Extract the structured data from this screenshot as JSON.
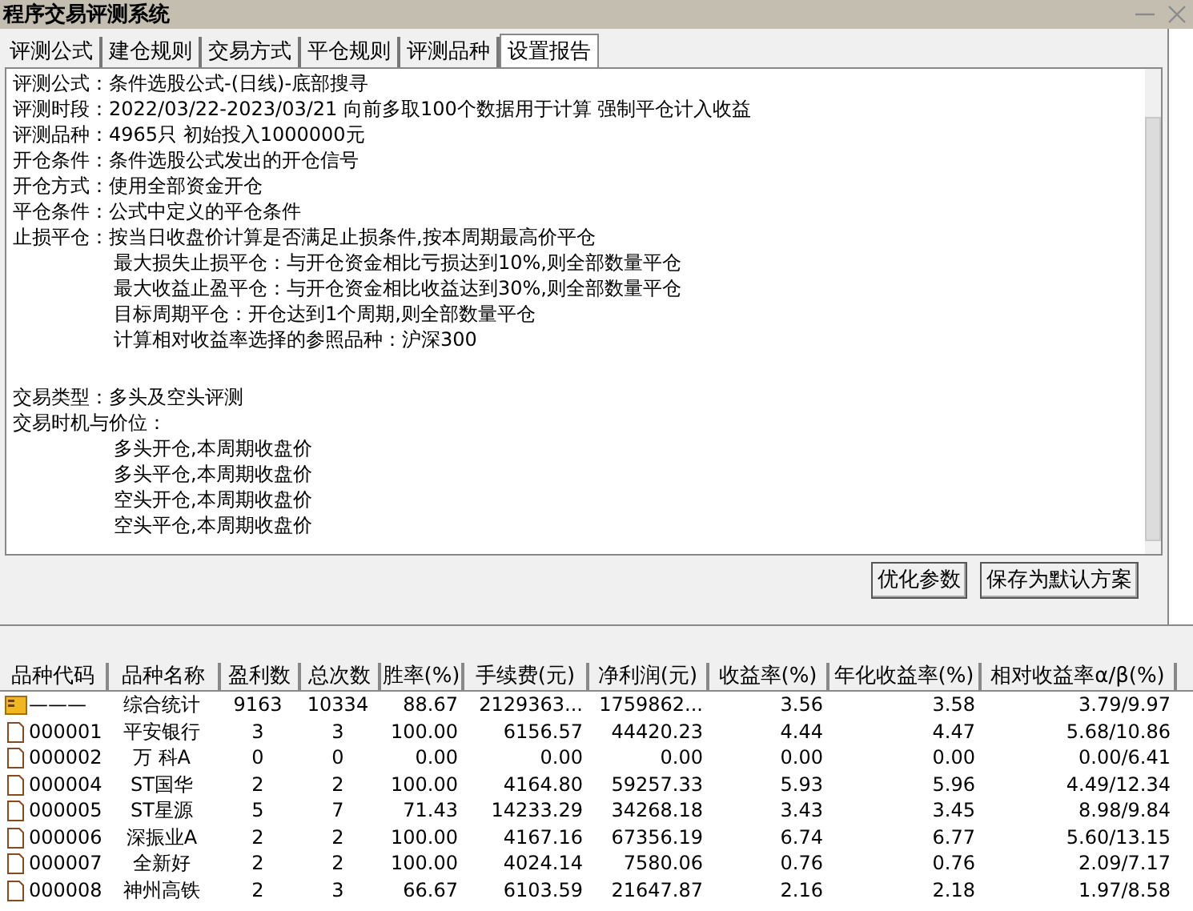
{
  "window": {
    "title": "程序交易评测系统"
  },
  "tabs": [
    {
      "label": "评测公式",
      "selected": false
    },
    {
      "label": "建仓规则",
      "selected": false
    },
    {
      "label": "交易方式",
      "selected": false
    },
    {
      "label": "平仓规则",
      "selected": false
    },
    {
      "label": "评测品种",
      "selected": false
    },
    {
      "label": "设置报告",
      "selected": true
    }
  ],
  "report": {
    "sections": [
      {
        "lines": [
          {
            "kind": "field",
            "label": "评测公式：",
            "text": "条件选股公式-(日线)-底部搜寻"
          },
          {
            "kind": "field",
            "label": "评测时段：",
            "text": "2022/03/22-2023/03/21 向前多取100个数据用于计算 强制平仓计入收益"
          },
          {
            "kind": "field",
            "label": "评测品种：",
            "text": "4965只 初始投入1000000元"
          },
          {
            "kind": "field",
            "label": "开仓条件：",
            "text": "条件选股公式发出的开仓信号"
          },
          {
            "kind": "field",
            "label": "开仓方式：",
            "text": "使用全部资金开仓"
          },
          {
            "kind": "field",
            "label": "平仓条件：",
            "text": "公式中定义的平仓条件"
          },
          {
            "kind": "field",
            "label": "止损平仓：",
            "text": "按当日收盘价计算是否满足止损条件,按本周期最高价平仓"
          },
          {
            "kind": "detail",
            "text": "最大损失止损平仓：与开仓资金相比亏损达到10%,则全部数量平仓"
          },
          {
            "kind": "detail",
            "text": "最大收益止盈平仓：与开仓资金相比收益达到30%,则全部数量平仓"
          },
          {
            "kind": "detail",
            "text": "目标周期平仓：开仓达到1个周期,则全部数量平仓"
          },
          {
            "kind": "detail",
            "text": "计算相对收益率选择的参照品种：沪深300"
          }
        ]
      },
      {
        "lines": [
          {
            "kind": "field",
            "label": "交易类型：",
            "text": "多头及空头评测"
          },
          {
            "kind": "field",
            "label": "交易时机与价位："
          },
          {
            "kind": "detail",
            "text": "多头开仓,本周期收盘价"
          },
          {
            "kind": "detail",
            "text": "多头平仓,本周期收盘价"
          },
          {
            "kind": "detail",
            "text": "空头开仓,本周期收盘价"
          },
          {
            "kind": "detail",
            "text": "空头平仓,本周期收盘价"
          }
        ]
      }
    ]
  },
  "buttons": [
    "优化参数",
    "保存为默认方案"
  ],
  "table": {
    "columns": [
      "品种代码",
      "品种名称",
      "盈利数",
      "总次数",
      "胜率(%)",
      "手续费(元)",
      "净利润(元)",
      "收益率(%)",
      "年化收益率(%)",
      "相对收益率α/β(%)"
    ],
    "rows": [
      {
        "kind": "summary",
        "cells": [
          "———",
          "综合统计",
          "9163",
          "10334",
          "88.67",
          "2129363...",
          "1759862...",
          "3.56",
          "3.58",
          "3.79/9.97"
        ]
      },
      {
        "kind": "stock",
        "cells": [
          "000001",
          "平安银行",
          "3",
          "3",
          "100.00",
          "6156.57",
          "44420.23",
          "4.44",
          "4.47",
          "5.68/10.86"
        ]
      },
      {
        "kind": "stock",
        "cells": [
          "000002",
          "万 科A",
          "0",
          "0",
          "0.00",
          "0.00",
          "0.00",
          "0.00",
          "0.00",
          "0.00/6.41"
        ]
      },
      {
        "kind": "stock",
        "cells": [
          "000004",
          "ST国华",
          "2",
          "2",
          "100.00",
          "4164.80",
          "59257.33",
          "5.93",
          "5.96",
          "4.49/12.34"
        ]
      },
      {
        "kind": "stock",
        "cells": [
          "000005",
          "ST星源",
          "5",
          "7",
          "71.43",
          "14233.29",
          "34268.18",
          "3.43",
          "3.45",
          "8.98/9.84"
        ]
      },
      {
        "kind": "stock",
        "cells": [
          "000006",
          "深振业A",
          "2",
          "2",
          "100.00",
          "4167.16",
          "67356.19",
          "6.74",
          "6.77",
          "5.60/13.15"
        ]
      },
      {
        "kind": "stock",
        "cells": [
          "000007",
          "全新好",
          "2",
          "2",
          "100.00",
          "4024.14",
          "7580.06",
          "0.76",
          "0.76",
          "2.09/7.17"
        ]
      },
      {
        "kind": "stock",
        "cells": [
          "000008",
          "神州高铁",
          "2",
          "3",
          "66.67",
          "6103.59",
          "21647.87",
          "2.16",
          "2.18",
          "1.97/8.58"
        ]
      }
    ]
  }
}
